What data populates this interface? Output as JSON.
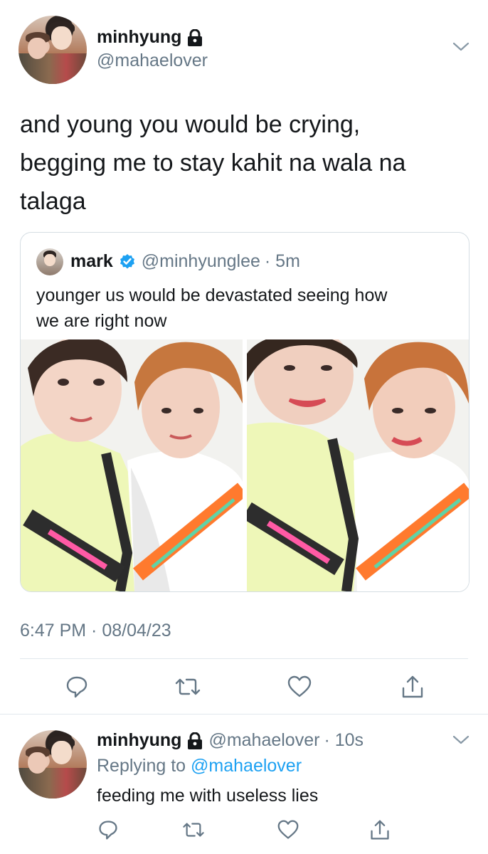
{
  "tweet": {
    "name": "minhyung",
    "handle": "@mahaelover",
    "text_line1": "and young you would be crying,",
    "text_line2": "begging me to stay kahit na wala na",
    "text_line3": "talaga",
    "timestamp": "6:47 PM · 08/04/23"
  },
  "quote": {
    "name": "mark",
    "handle": "@minhyunglee",
    "time": "· 5m",
    "text_line1": "younger us would be devastated seeing how",
    "text_line2": "we are right now"
  },
  "reply": {
    "name": "minhyung",
    "handle": "@mahaelover",
    "time": "· 10s",
    "replying_prefix": "Replying to",
    "replying_handle": "@mahaelover",
    "text": "feeding me with useless lies"
  },
  "colors": {
    "primary_text": "#14171a",
    "secondary_text": "#657786",
    "link": "#1da1f2",
    "verified": "#1da1f2",
    "icon": "#657786",
    "divider": "#e1e8ed"
  },
  "icons": [
    "lock-icon",
    "chevron-down-icon",
    "verified-badge-icon",
    "reply-icon",
    "retweet-icon",
    "like-icon",
    "share-icon"
  ]
}
